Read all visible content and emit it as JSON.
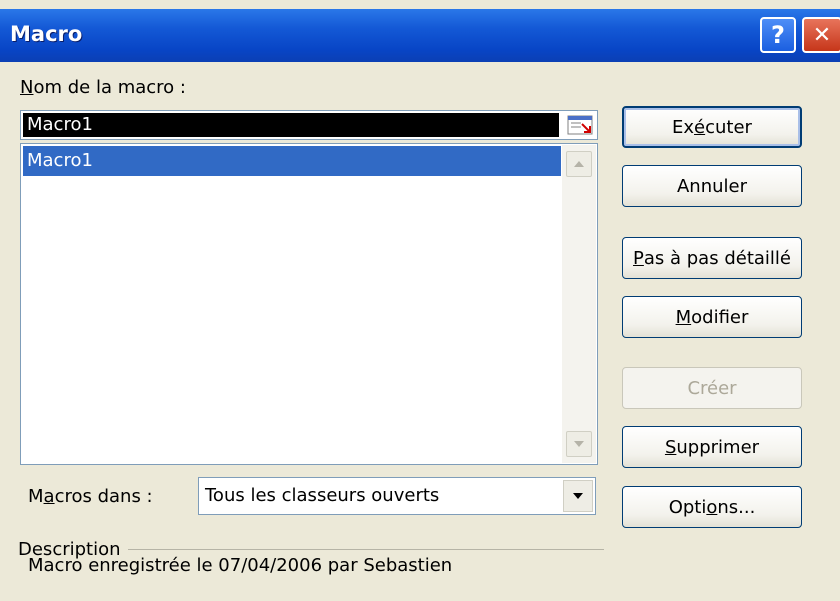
{
  "window": {
    "title": "Macro",
    "help_label": "?",
    "close_label": "✕"
  },
  "macro_name": {
    "label_underlined": "N",
    "label_rest": "om de la macro :",
    "value": "Macro1"
  },
  "macro_list": {
    "items": [
      "Macro1"
    ],
    "selected": "Macro1"
  },
  "buttons": {
    "run": {
      "before": "Ex",
      "underlined": "é",
      "after": "cuter"
    },
    "cancel": {
      "label": "Annuler"
    },
    "step_into": {
      "before": "",
      "underlined": "P",
      "after": "as à pas détaillé"
    },
    "edit": {
      "before": "",
      "underlined": "M",
      "after": "odifier"
    },
    "create": {
      "label": "Créer",
      "disabled": true
    },
    "delete": {
      "before": "",
      "underlined": "S",
      "after": "upprimer"
    },
    "options": {
      "before": "Opti",
      "underlined": "o",
      "after": "ns..."
    }
  },
  "macros_in": {
    "label_before": "M",
    "label_underlined": "a",
    "label_after": "cros dans :",
    "value": "Tous les classeurs ouverts"
  },
  "description": {
    "label": "Description",
    "text": "Macro enregistrée le 07/04/2006 par Sebastien"
  },
  "colors": {
    "titlebar": "#0845C6",
    "selection": "#316AC5",
    "dialog_bg": "#ECE9D8"
  }
}
